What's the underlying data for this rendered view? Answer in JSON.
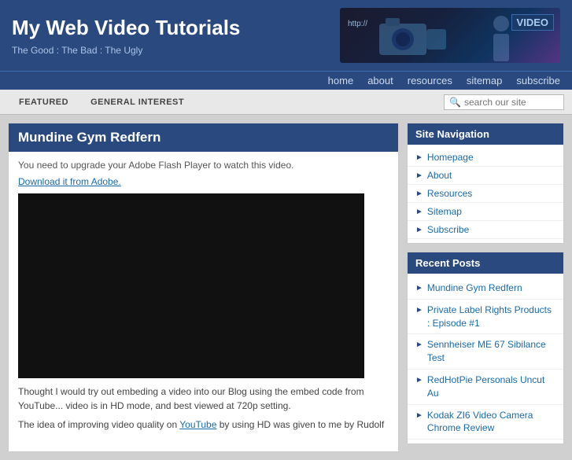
{
  "header": {
    "title": "My Web Video Tutorials",
    "tagline": "The Good : The Bad : The Ugly",
    "banner_url": "http://",
    "banner_video": "VIDEO"
  },
  "nav": {
    "items": [
      "home",
      "about",
      "resources",
      "sitemap",
      "subscribe"
    ]
  },
  "subnav": {
    "items": [
      "FEATURED",
      "GENERAL INTEREST"
    ],
    "search_placeholder": "search our site"
  },
  "post": {
    "title": "Mundine Gym Redfern",
    "flash_notice": "You need to upgrade your Adobe Flash Player to watch this video.",
    "flash_link": "Download it from Adobe.",
    "description": "Thought I would try out embeding a video into our Blog using the embed code from YouTube... video is in HD mode, and best viewed at 720p setting.",
    "idea_text": "The idea of improving video quality on ",
    "youtube_text": "YouTube",
    "idea_cont": " by using HD was given to me by Rudolf"
  },
  "sidebar": {
    "nav_title": "Site Navigation",
    "nav_items": [
      {
        "label": "Homepage"
      },
      {
        "label": "About"
      },
      {
        "label": "Resources"
      },
      {
        "label": "Sitemap"
      },
      {
        "label": "Subscribe"
      }
    ],
    "recent_title": "Recent Posts",
    "recent_items": [
      {
        "label": "Mundine Gym Redfern"
      },
      {
        "label": "Private Label Rights Products : Episode #1"
      },
      {
        "label": "Sennheiser ME 67 Sibilance Test"
      },
      {
        "label": "RedHotPie Personals Uncut Au"
      },
      {
        "label": "Kodak ZI6 Video Camera Chrome Review"
      }
    ]
  }
}
